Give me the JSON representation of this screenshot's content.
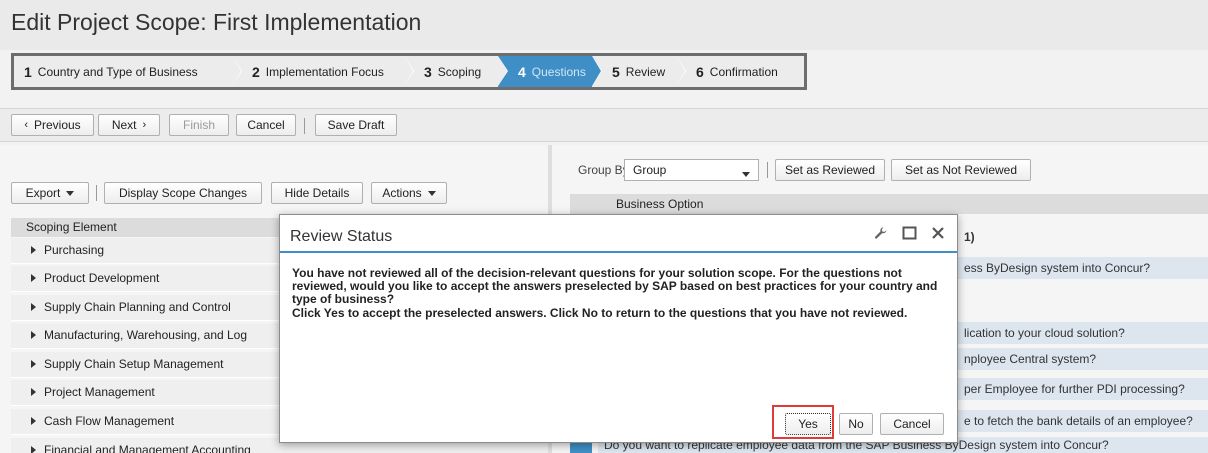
{
  "page": {
    "title": "Edit Project Scope: First Implementation"
  },
  "roadmap": {
    "steps": [
      {
        "num": "1",
        "label": "Country and Type of Business"
      },
      {
        "num": "2",
        "label": "Implementation Focus"
      },
      {
        "num": "3",
        "label": "Scoping"
      },
      {
        "num": "4",
        "label": "Questions"
      },
      {
        "num": "5",
        "label": "Review"
      },
      {
        "num": "6",
        "label": "Confirmation"
      }
    ],
    "active_step": 4,
    "active_color": "#3f8fc6"
  },
  "toolbar": {
    "previous": "Previous",
    "next": "Next",
    "finish": "Finish",
    "cancel": "Cancel",
    "save_draft": "Save Draft"
  },
  "left_toolbar": {
    "export": "Export",
    "display_scope_changes": "Display Scope Changes",
    "hide_details": "Hide Details",
    "actions": "Actions"
  },
  "scope_tree": {
    "header": "Scoping Element",
    "items": [
      "Purchasing",
      "Product Development",
      "Supply Chain Planning and Control",
      "Manufacturing, Warehousing, and Log",
      "Supply Chain Setup Management",
      "Project Management",
      "Cash Flow Management",
      "Financial and Management Accounting"
    ]
  },
  "right_toolbar": {
    "group_by_label": "Group By",
    "group_by_value": "Group",
    "set_reviewed": "Set as Reviewed",
    "set_not_reviewed": "Set as Not Reviewed"
  },
  "questions": {
    "header": "Business Option",
    "partial_header": "1)",
    "rows": [
      "ess ByDesign system into Concur?",
      "lication to your cloud solution?",
      "nployee Central system?",
      "per Employee for further PDI processing?",
      "e to fetch the bank details of an employee?",
      "Do you want to replicate employee data from the SAP Business ByDesign system into Concur?"
    ]
  },
  "dialog": {
    "title": "Review Status",
    "paragraph1": "You have not reviewed all of the decision-relevant questions for your solution scope. For the questions not reviewed, would you like to accept the answers preselected by SAP based on best practices for your country and type of business?",
    "paragraph2": "Click Yes to accept the preselected answers. Click No to return to the questions that you have not reviewed.",
    "yes": "Yes",
    "no": "No",
    "cancel": "Cancel",
    "highlight_color": "#e03a3a"
  }
}
